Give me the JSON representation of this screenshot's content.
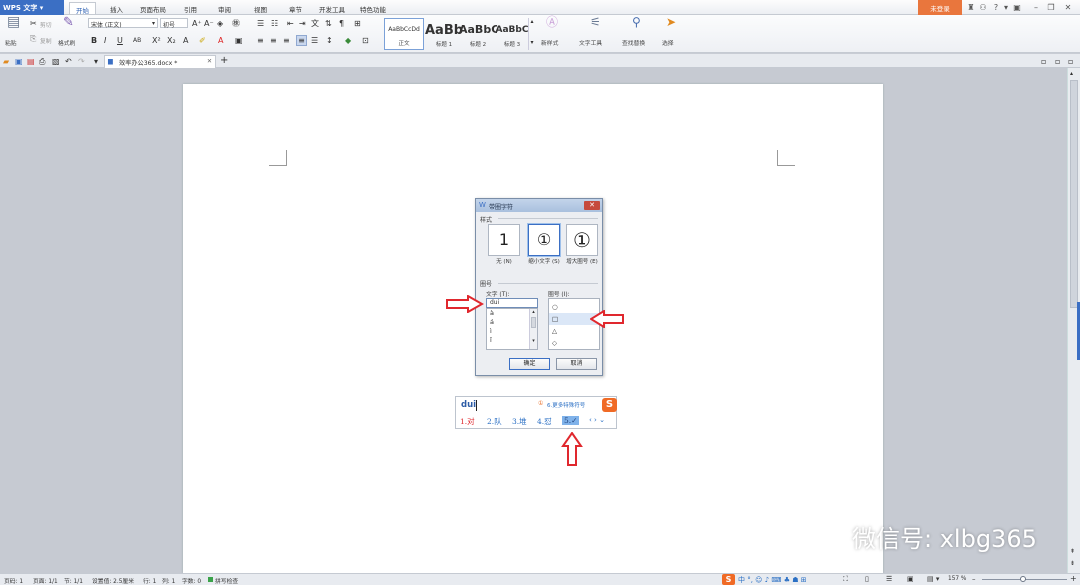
{
  "app": {
    "title": "WPS 文字",
    "login_label": "未登录"
  },
  "menu": {
    "tabs": [
      "开始",
      "插入",
      "页面布局",
      "引用",
      "审阅",
      "视图",
      "章节",
      "开发工具",
      "特色功能"
    ]
  },
  "ribbon": {
    "paste": "粘贴",
    "cut": "剪切",
    "copy": "复制",
    "format_painter": "格式刷",
    "font_name": "宋体 (正文)",
    "font_size": "初号",
    "styles": [
      {
        "preview": "AaBbCcDd",
        "label": "正文"
      },
      {
        "preview": "AaBb",
        "label": "标题 1"
      },
      {
        "preview": "AaBbC",
        "label": "标题 2"
      },
      {
        "preview": "AaBbC",
        "label": "标题 3"
      }
    ],
    "new_style": "新样式",
    "text_tools": "文字工具",
    "find_replace": "查找替换",
    "select": "选择"
  },
  "doc_tab": {
    "name": "效率办公365.docx *"
  },
  "dialog": {
    "title": "带圈字符",
    "style_section": "样式",
    "options": [
      {
        "glyph": "1",
        "label": "无 (N)"
      },
      {
        "glyph": "①",
        "label": "缩小文字 (S)"
      },
      {
        "glyph": "①",
        "label": "增大圈号 (E)"
      }
    ],
    "enclosure_section": "圈号",
    "text_label": "文字 (T):",
    "text_value": "dui",
    "text_items": [
      "à",
      "á",
      "ì",
      "ǐ"
    ],
    "shape_label": "圈号 (I):",
    "shapes": [
      "○",
      "□",
      "△",
      "◇"
    ],
    "ok": "确定",
    "cancel": "取消"
  },
  "ime": {
    "input": "dui",
    "hint": "6.更多特殊符号",
    "candidates": [
      "1.对",
      "2.队",
      "3.堆",
      "4.怼",
      "5.✓"
    ]
  },
  "status": {
    "page": "页码: 1",
    "pages": "页面: 1/1",
    "section": "节: 1/1",
    "setting": "设置值: 2.5厘米",
    "row": "行: 1",
    "col": "列: 1",
    "words": "字数: 0",
    "spell": "拼写检查",
    "zoom": "157 %"
  },
  "watermark": {
    "text": "微信号: xlbg365"
  },
  "colors": {
    "accent": "#3b6fc4",
    "login": "#e9763d",
    "arrow": "#e0282e"
  }
}
